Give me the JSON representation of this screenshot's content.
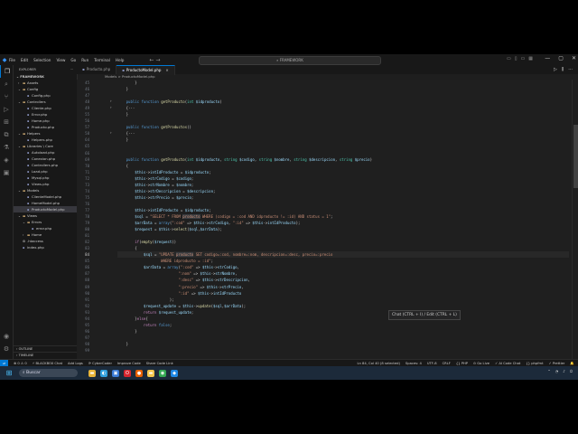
{
  "titlebar": {
    "menu": [
      "File",
      "Edit",
      "Selection",
      "View",
      "Go",
      "Run",
      "Terminal",
      "Help"
    ],
    "search_text": "FRAMEWORK",
    "nav_back": "←",
    "nav_forward": "→",
    "win_min": "—",
    "win_max": "▢",
    "win_close": "✕",
    "layout_icons": [
      "▭",
      "▯",
      "▭",
      "▦"
    ]
  },
  "activity": {
    "icons": [
      "explorer-icon",
      "search-icon",
      "source-control-icon",
      "run-debug-icon",
      "extensions-icon",
      "remote-explorer-icon",
      "testing-icon",
      "docker-icon",
      "blackbox-icon"
    ],
    "glyphs": [
      "❐",
      "⌕",
      "⑂",
      "▷",
      "⊞",
      "⧉",
      "⚗",
      "◈",
      "▣"
    ],
    "bottom_glyphs": [
      "◉",
      "⚙"
    ]
  },
  "sidebar": {
    "header": "EXPLORER",
    "header_more": "···",
    "root": "FRAMEWORK",
    "tree": [
      {
        "label": "Assets",
        "indent": 1,
        "type": "folder",
        "open": false
      },
      {
        "label": "Config",
        "indent": 1,
        "type": "folder",
        "open": true
      },
      {
        "label": "Config.php",
        "indent": 2,
        "type": "php"
      },
      {
        "label": "Controllers",
        "indent": 1,
        "type": "folder",
        "open": true
      },
      {
        "label": "Cliente.php",
        "indent": 2,
        "type": "php"
      },
      {
        "label": "Error.php",
        "indent": 2,
        "type": "php"
      },
      {
        "label": "Home.php",
        "indent": 2,
        "type": "php"
      },
      {
        "label": "Producto.php",
        "indent": 2,
        "type": "php"
      },
      {
        "label": "Helpers",
        "indent": 1,
        "type": "folder",
        "open": true
      },
      {
        "label": "Helpers.php",
        "indent": 2,
        "type": "php"
      },
      {
        "label": "Libraries \\ Core",
        "indent": 1,
        "type": "folder",
        "open": true
      },
      {
        "label": "Autoload.php",
        "indent": 2,
        "type": "php"
      },
      {
        "label": "Conexion.php",
        "indent": 2,
        "type": "php"
      },
      {
        "label": "Controllers.php",
        "indent": 2,
        "type": "php"
      },
      {
        "label": "Load.php",
        "indent": 2,
        "type": "php"
      },
      {
        "label": "Mysql.php",
        "indent": 2,
        "type": "php"
      },
      {
        "label": "Views.php",
        "indent": 2,
        "type": "php"
      },
      {
        "label": "Models",
        "indent": 1,
        "type": "folder",
        "open": true
      },
      {
        "label": "ClienteModel.php",
        "indent": 2,
        "type": "php"
      },
      {
        "label": "HomeModel.php",
        "indent": 2,
        "type": "php"
      },
      {
        "label": "ProductoModel.php",
        "indent": 2,
        "type": "php",
        "selected": true
      },
      {
        "label": "Views",
        "indent": 1,
        "type": "folder",
        "open": true
      },
      {
        "label": "Errors",
        "indent": 2,
        "type": "folder",
        "open": true
      },
      {
        "label": "error.php",
        "indent": 3,
        "type": "php"
      },
      {
        "label": "Home",
        "indent": 2,
        "type": "folder",
        "open": false
      },
      {
        "label": ".htaccess",
        "indent": 1,
        "type": "htaccess"
      },
      {
        "label": "index.php",
        "indent": 1,
        "type": "php"
      }
    ],
    "outline": "OUTLINE",
    "timeline": "TIMELINE"
  },
  "tabs": [
    {
      "label": "Producto.php",
      "active": false
    },
    {
      "label": "ProductoModel.php",
      "active": true
    }
  ],
  "tab_close": "×",
  "tab_actions": [
    "▷",
    "⫼",
    "···"
  ],
  "breadcrumb": "Models > ProductoModel.php",
  "editor": {
    "active_line": 84,
    "lines": [
      {
        "n": 45,
        "html": "        <span class=\"pu\">}</span>"
      },
      {
        "n": 46,
        "html": "    <span class=\"pu\">}</span>"
      },
      {
        "n": 47,
        "html": ""
      },
      {
        "n": 48,
        "html": "    <span class=\"kw\">public</span> <span class=\"kw\">function</span> <span class=\"fn\">getProducto</span>(<span class=\"ty\">int</span> <span class=\"var\">$idproducto</span>)",
        "fold": "›"
      },
      {
        "n": 49,
        "html": "    <span class=\"pu\">{···</span>",
        "fold": "›"
      },
      {
        "n": 55,
        "html": "    <span class=\"pu\">}</span>"
      },
      {
        "n": 56,
        "html": ""
      },
      {
        "n": 57,
        "html": "    <span class=\"kw\">public</span> <span class=\"kw\">function</span> <span class=\"fn\">getProductos</span>()"
      },
      {
        "n": 58,
        "html": "    <span class=\"pu\">{···</span>",
        "fold": "›"
      },
      {
        "n": 64,
        "html": "    <span class=\"pu\">}</span>"
      },
      {
        "n": 65,
        "html": ""
      },
      {
        "n": 66,
        "html": ""
      },
      {
        "n": 69,
        "html": "    <span class=\"kw\">public</span> <span class=\"kw\">function</span> <span class=\"fn\">getProducto</span>(<span class=\"ty\">int</span> <span class=\"var\">$idproducto</span>, <span class=\"ty\">string</span> <span class=\"var\">$codigo</span>, <span class=\"ty\">string</span> <span class=\"var\">$nombre</span>, <span class=\"ty\">string</span> <span class=\"var\">$descripcion</span>, <span class=\"ty\">string</span> <span class=\"var\">$precio</span>)"
      },
      {
        "n": 70,
        "html": "    <span class=\"pu\">{</span>"
      },
      {
        "n": 71,
        "html": "        <span class=\"var\">$this</span>-&gt;<span class=\"var\">intIdProducto</span> = <span class=\"var\">$idproducto</span>;"
      },
      {
        "n": 72,
        "html": "        <span class=\"var\">$this</span>-&gt;<span class=\"var\">strCodigo</span> = <span class=\"var\">$codigo</span>;"
      },
      {
        "n": 73,
        "html": "        <span class=\"var\">$this</span>-&gt;<span class=\"var\">strNombre</span> = <span class=\"var\">$nombre</span>;"
      },
      {
        "n": 74,
        "html": "        <span class=\"var\">$this</span>-&gt;<span class=\"var\">strDescripcion</span> = <span class=\"var\">$descripcion</span>;"
      },
      {
        "n": 75,
        "html": "        <span class=\"var\">$this</span>-&gt;<span class=\"var\">strPrecio</span> = <span class=\"var\">$precio</span>;"
      },
      {
        "n": 76,
        "html": ""
      },
      {
        "n": 77,
        "html": "        <span class=\"var\">$this</span>-&gt;<span class=\"var\">intIdProducto</span> = <span class=\"var\">$idproducto</span>;"
      },
      {
        "n": 78,
        "html": "        <span class=\"var\">$sql</span> = <span class=\"str\">\"SELECT * FROM <span class=\"hl\">producto</span> WHERE (codigo = :cod AND idproducto != :id) AND status = 1\"</span>;"
      },
      {
        "n": 79,
        "html": "        <span class=\"var\">$arrData</span> = <span class=\"kw\">array</span>(<span class=\"str\">\":cod\"</span> =&gt; <span class=\"var\">$this</span>-&gt;<span class=\"var\">strCodigo</span>, <span class=\"str\">\":id\"</span> =&gt; <span class=\"var\">$this</span>-&gt;<span class=\"var\">intIdProducto</span>);"
      },
      {
        "n": 80,
        "html": "        <span class=\"var\">$request</span> = <span class=\"var\">$this</span>-&gt;<span class=\"fn\">select</span>(<span class=\"var\">$sql</span>,<span class=\"var\">$arrData</span>);"
      },
      {
        "n": 81,
        "html": ""
      },
      {
        "n": 82,
        "html": "        <span class=\"ctl\">if</span>(<span class=\"fn\">empty</span>(<span class=\"var\">$request</span>))"
      },
      {
        "n": 83,
        "html": "        <span class=\"pu\">{</span>"
      },
      {
        "n": 84,
        "html": "            <span class=\"var\">$sql</span> = <span class=\"str\">\"UPDATE <span class=\"hl\">producto</span> SET codigo=:cod, nombre=:nom, descripcion=:desc, precio=:precio</span>"
      },
      {
        "n": 85,
        "html": "<span class=\"str\">                    WHERE idproducto = :id\"</span>;"
      },
      {
        "n": 86,
        "html": "            <span class=\"var\">$arrData</span> = <span class=\"kw\">array</span>(<span class=\"str\">\":cod\"</span> =&gt; <span class=\"var\">$this</span>-&gt;<span class=\"var\">strCodigo</span>,"
      },
      {
        "n": 87,
        "html": "                            <span class=\"str\">\":nom\"</span> =&gt; <span class=\"var\">$this</span>-&gt;<span class=\"var\">strNombre</span>,"
      },
      {
        "n": 88,
        "html": "                            <span class=\"str\">\":desc\"</span> =&gt; <span class=\"var\">$this</span>-&gt;<span class=\"var\">strDescripcion</span>,"
      },
      {
        "n": 89,
        "html": "                            <span class=\"str\">\":precio\"</span> =&gt; <span class=\"var\">$this</span>-&gt;<span class=\"var\">strPrecio</span>,"
      },
      {
        "n": 90,
        "html": "                            <span class=\"str\">\":id\"</span> =&gt; <span class=\"var\">$this</span>-&gt;<span class=\"var\">intIdProducto</span>"
      },
      {
        "n": 91,
        "html": "                        );"
      },
      {
        "n": 92,
        "html": "            <span class=\"var\">$request_update</span> = <span class=\"var\">$this</span>-&gt;<span class=\"fn\">update</span>(<span class=\"var\">$sql</span>,<span class=\"var\">$arrData</span>);"
      },
      {
        "n": 93,
        "html": "            <span class=\"ctl\">return</span> <span class=\"var\">$request_update</span>;"
      },
      {
        "n": 94,
        "html": "        <span class=\"pu\">}</span><span class=\"ctl\">else</span><span class=\"pu\">{</span>"
      },
      {
        "n": 95,
        "html": "            <span class=\"ctl\">return</span> <span class=\"kw\">false</span>;"
      },
      {
        "n": 96,
        "html": "        <span class=\"pu\">}</span>"
      },
      {
        "n": 97,
        "html": ""
      },
      {
        "n": 98,
        "html": "    <span class=\"pu\">}</span>"
      },
      {
        "n": 99,
        "html": ""
      }
    ]
  },
  "inline_chat_hint": "Chat (CTRL + I) / Edit (CTRL + L)",
  "statusbar": {
    "left": [
      "⊗ 0 ⚠ 0",
      "⚡ BLACKBOX Chat",
      "Add Logs",
      "⟳ CyberCoder",
      "Improve Code",
      "Share Code Link"
    ],
    "remote": "⇌",
    "right": [
      "Ln 84, Col 40 (8 selected)",
      "Spaces: 4",
      "UTF-8",
      "CRLF",
      "{} PHP",
      "⊙ Go Live",
      "✓ AI Code Chat",
      "{} phpfmt",
      "✓ Prettier",
      "🔔"
    ]
  },
  "taskbar": {
    "start": "⊞",
    "search": "Buscar",
    "apps": [
      {
        "name": "file-explorer-icon",
        "glyph": "▬",
        "color": "#e8b53a"
      },
      {
        "name": "edge-icon",
        "glyph": "◐",
        "color": "#2f9fdd"
      },
      {
        "name": "store-icon",
        "glyph": "▣",
        "color": "#3a7bd5"
      },
      {
        "name": "opera-icon",
        "glyph": "O",
        "color": "#d6252e"
      },
      {
        "name": "firefox-icon",
        "glyph": "●",
        "color": "#e66000"
      },
      {
        "name": "folder-icon",
        "glyph": "▬",
        "color": "#f3c74e"
      },
      {
        "name": "chrome-icon",
        "glyph": "◉",
        "color": "#34a853"
      },
      {
        "name": "vscode-icon",
        "glyph": "◆",
        "color": "#1e88e5"
      }
    ],
    "tray": [
      "⌃",
      "◔",
      "♪",
      "⏻"
    ]
  }
}
